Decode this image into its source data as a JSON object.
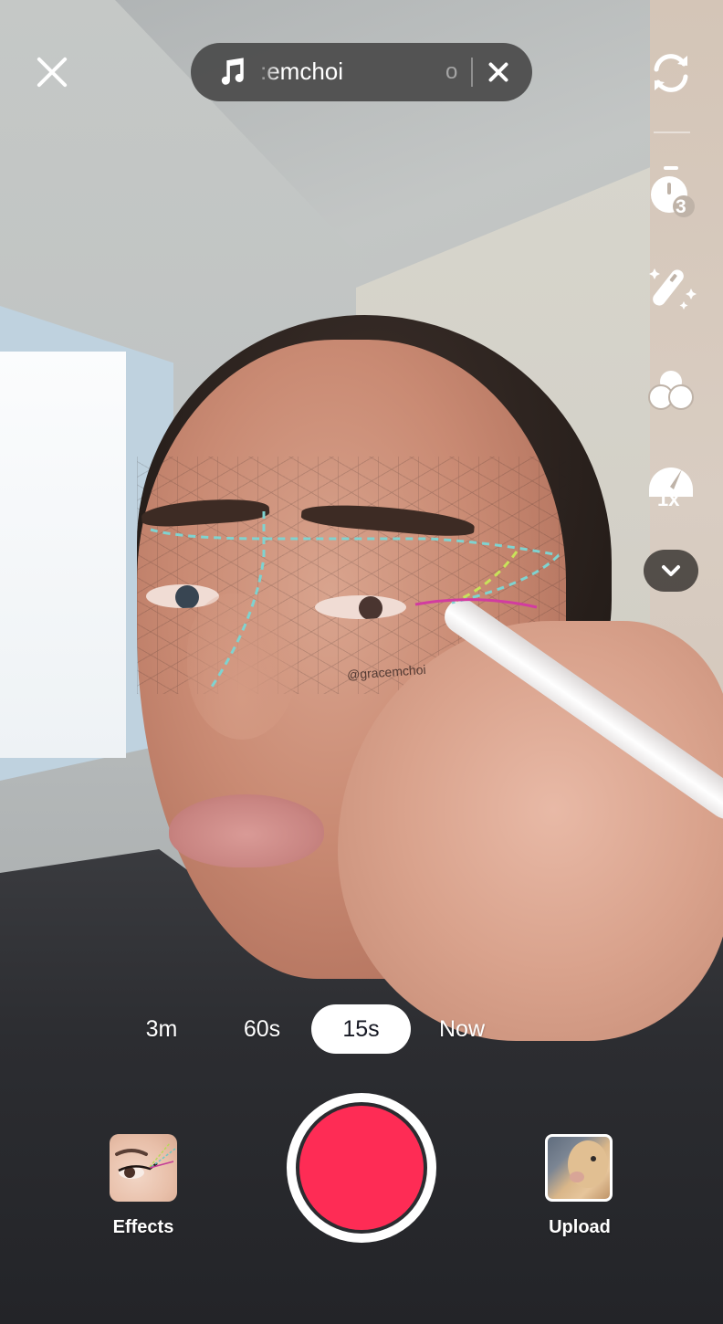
{
  "app": "TikTok camera",
  "top_bar": {
    "close_icon": "close-icon",
    "sound": {
      "icon": "music-note-icon",
      "title": ":emchoi",
      "tail_fragment": "o",
      "remove_icon": "close-icon"
    }
  },
  "side_rail": {
    "items": [
      {
        "name": "flip-camera",
        "icon": "flip-camera-icon"
      },
      {
        "name": "timer",
        "icon": "timer-icon",
        "badge": "3"
      },
      {
        "name": "beauty-enhance",
        "icon": "magic-wand-icon"
      },
      {
        "name": "filters",
        "icon": "filters-icon"
      },
      {
        "name": "speed",
        "icon": "speedometer-icon",
        "badge": "1x"
      },
      {
        "name": "more",
        "icon": "chevron-down-icon"
      }
    ]
  },
  "effect_overlay": {
    "watermark": "@gracemchoi",
    "guide_colors": {
      "cyan": "#7fd3d0",
      "lime": "#c8e35a",
      "magenta": "#d23ca0"
    }
  },
  "duration_modes": {
    "items": [
      "3m",
      "60s",
      "15s",
      "Now"
    ],
    "selected": "15s"
  },
  "bottom_bar": {
    "effects_label": "Effects",
    "upload_label": "Upload",
    "record_color": "#fe2c55"
  }
}
